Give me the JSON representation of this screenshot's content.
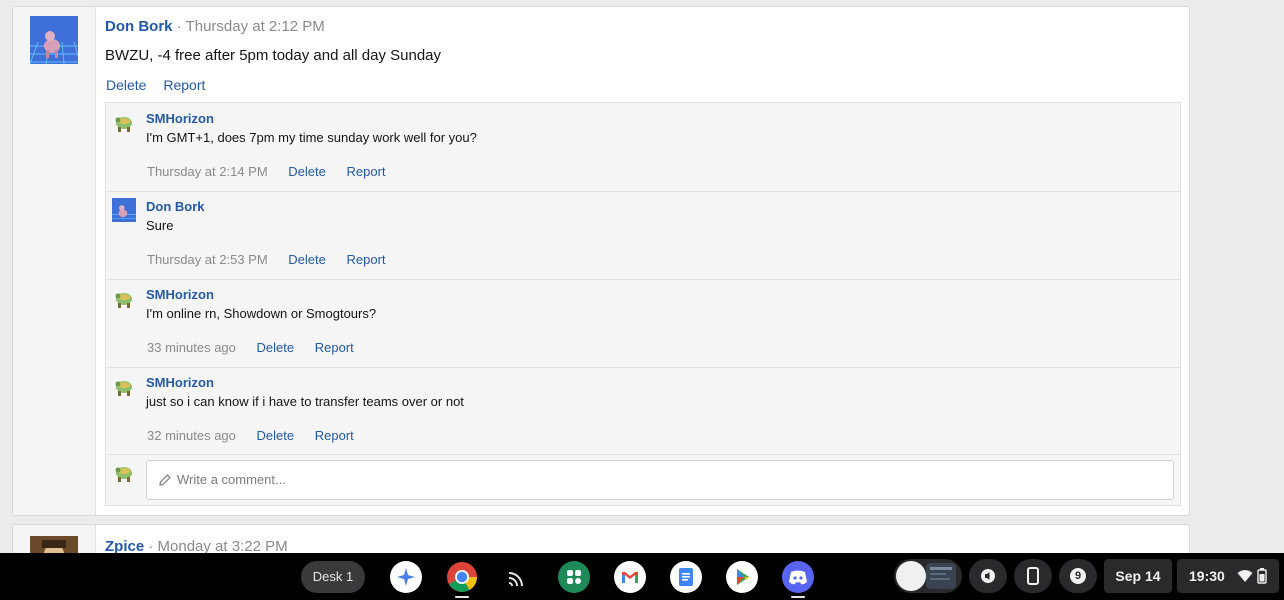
{
  "post": {
    "author": "Don Bork",
    "meta": "· Thursday at 2:12 PM",
    "text": "BWZU, -4 free after 5pm today and all day Sunday",
    "delete_label": "Delete",
    "report_label": "Report"
  },
  "comments": [
    {
      "author": "SMHorizon",
      "text": "I'm GMT+1, does 7pm my time sunday work well for you?",
      "time": "Thursday at 2:14 PM",
      "delete_label": "Delete",
      "report_label": "Report"
    },
    {
      "author": "Don Bork",
      "text": "Sure",
      "time": "Thursday at 2:53 PM",
      "delete_label": "Delete",
      "report_label": "Report"
    },
    {
      "author": "SMHorizon",
      "text": "I'm online rn, Showdown or Smogtours?",
      "time": "33 minutes ago",
      "delete_label": "Delete",
      "report_label": "Report"
    },
    {
      "author": "SMHorizon",
      "text": "just so i can know if i have to transfer teams over or not",
      "time": "32 minutes ago",
      "delete_label": "Delete",
      "report_label": "Report"
    }
  ],
  "comment_input": {
    "placeholder": "Write a comment..."
  },
  "post2": {
    "author": "Zpice",
    "meta": "· Monday at 3:22 PM"
  },
  "shelf": {
    "desk_label": "Desk 1",
    "apps": [
      "assistant-icon",
      "chrome-icon",
      "cast-icon",
      "app-grid-icon",
      "gmail-icon",
      "docs-icon",
      "play-store-icon",
      "discord-icon"
    ],
    "notification_count": "9",
    "date": "Sep 14",
    "time": "19:30"
  },
  "colors": {
    "link": "#2459a8",
    "muted": "#8a8a8a",
    "shelf": "#000000"
  }
}
